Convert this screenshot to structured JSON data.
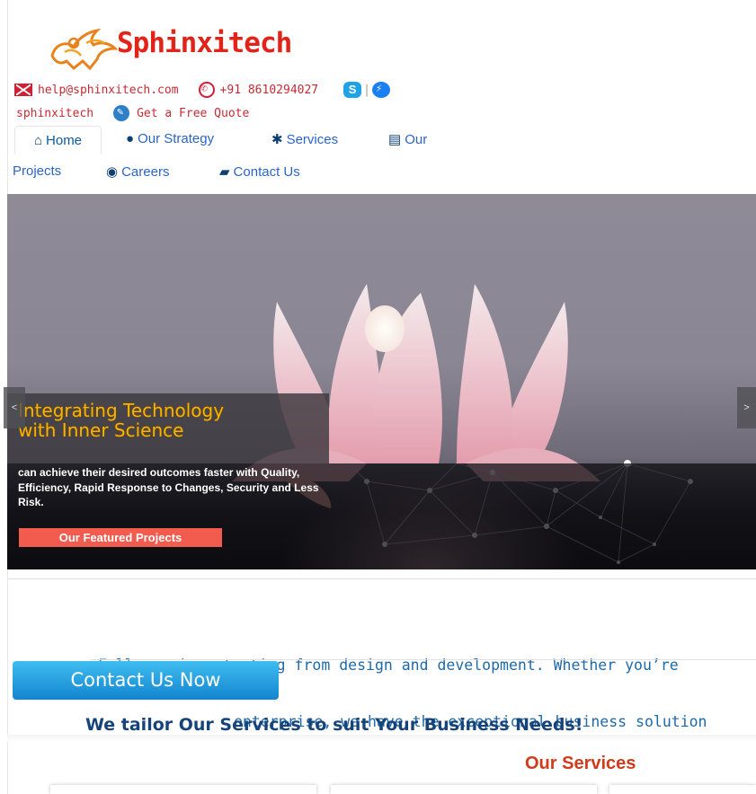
{
  "brand": {
    "name": "Sphinxitech",
    "color": "#e2231a"
  },
  "contact": {
    "email": "help@sphinxitech.com",
    "phone": "+91 8610294027",
    "skype_id": "sphinxitech",
    "quote_label": "Get a Free Quote"
  },
  "nav": {
    "home": "Home",
    "strategy": "Our Strategy",
    "services": "Services",
    "projects_a": "Our",
    "projects_b": "Projects",
    "careers": "Careers",
    "contact": "Contact Us"
  },
  "slider": {
    "title_line1": "Integrating Technology",
    "title_line2": "with Inner Science",
    "text": "can achieve their desired outcomes faster with Quality, Efficiency, Rapid Response to Changes, Security and Less Risk.",
    "cta": "Our Featured Projects",
    "prev": "<",
    "next": ">"
  },
  "tagline": {
    "line1": "Full-service starting from design and development. Whether you’re",
    "line2": "enterprise, we have the exceptional business solution"
  },
  "contact_now": "Contact Us Now",
  "tailor_heading": "We tailor Our Services to suit Your Business Needs!",
  "services_heading": "Our Services",
  "colors": {
    "accent": "#2b64c8",
    "cta_red": "#f15c4f",
    "title_gold": "#f6b400"
  }
}
